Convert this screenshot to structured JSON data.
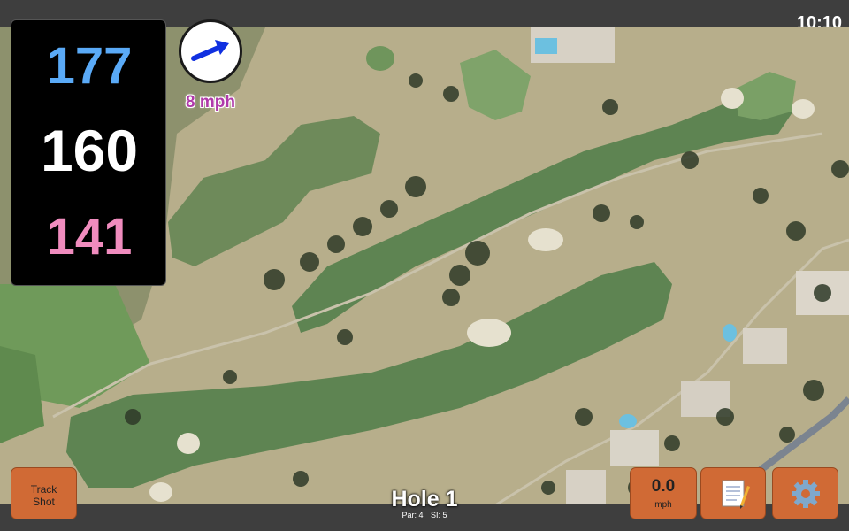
{
  "status": {
    "time": "10:10"
  },
  "distances": {
    "back": "177",
    "middle": "160",
    "front": "141"
  },
  "wind": {
    "speed": "8 mph",
    "icon": "wind-arrow-icon"
  },
  "hole": {
    "title": "Hole 1",
    "par": "Par: 4",
    "stroke_index": "SI: 5"
  },
  "buttons": {
    "track_shot": {
      "line1": "Track",
      "line2": "Shot"
    },
    "shot_speed": {
      "value": "0.0",
      "unit": "mph"
    },
    "notes": {
      "icon": "notepad-icon"
    },
    "settings": {
      "icon": "gear-icon"
    }
  },
  "colors": {
    "back_distance": "#5aaaf7",
    "middle_distance": "#ffffff",
    "front_distance": "#f08cbe",
    "button": "#d06a35",
    "wind_label": "#b03aaa"
  }
}
